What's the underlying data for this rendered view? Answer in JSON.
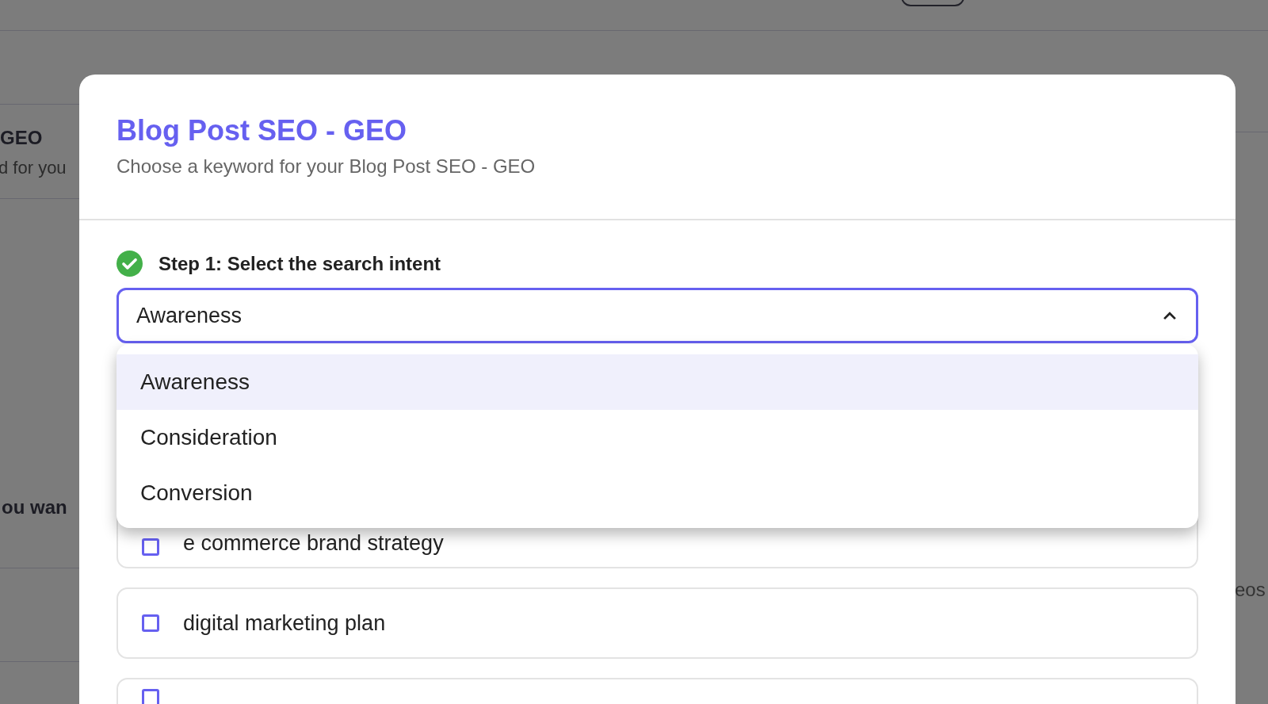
{
  "background": {
    "texts": [
      {
        "kind": "title",
        "text": "GEO"
      },
      {
        "kind": "subtitle",
        "text": "d for you"
      },
      {
        "kind": "question",
        "text": "ou wan"
      },
      {
        "kind": "side",
        "text": "eos"
      }
    ]
  },
  "modal": {
    "title": "Blog Post SEO - GEO",
    "subtitle": "Choose a keyword for your Blog Post SEO - GEO",
    "step": {
      "label": "Step 1: Select the search intent",
      "done": true
    },
    "select": {
      "value": "Awareness",
      "expanded": true,
      "options": [
        {
          "label": "Awareness",
          "selected": true
        },
        {
          "label": "Consideration",
          "selected": false
        },
        {
          "label": "Conversion",
          "selected": false
        }
      ]
    },
    "keywords": [
      {
        "label": "e commerce brand strategy",
        "checked": false
      },
      {
        "label": "digital marketing plan",
        "checked": false
      },
      {
        "checked": false
      }
    ]
  }
}
